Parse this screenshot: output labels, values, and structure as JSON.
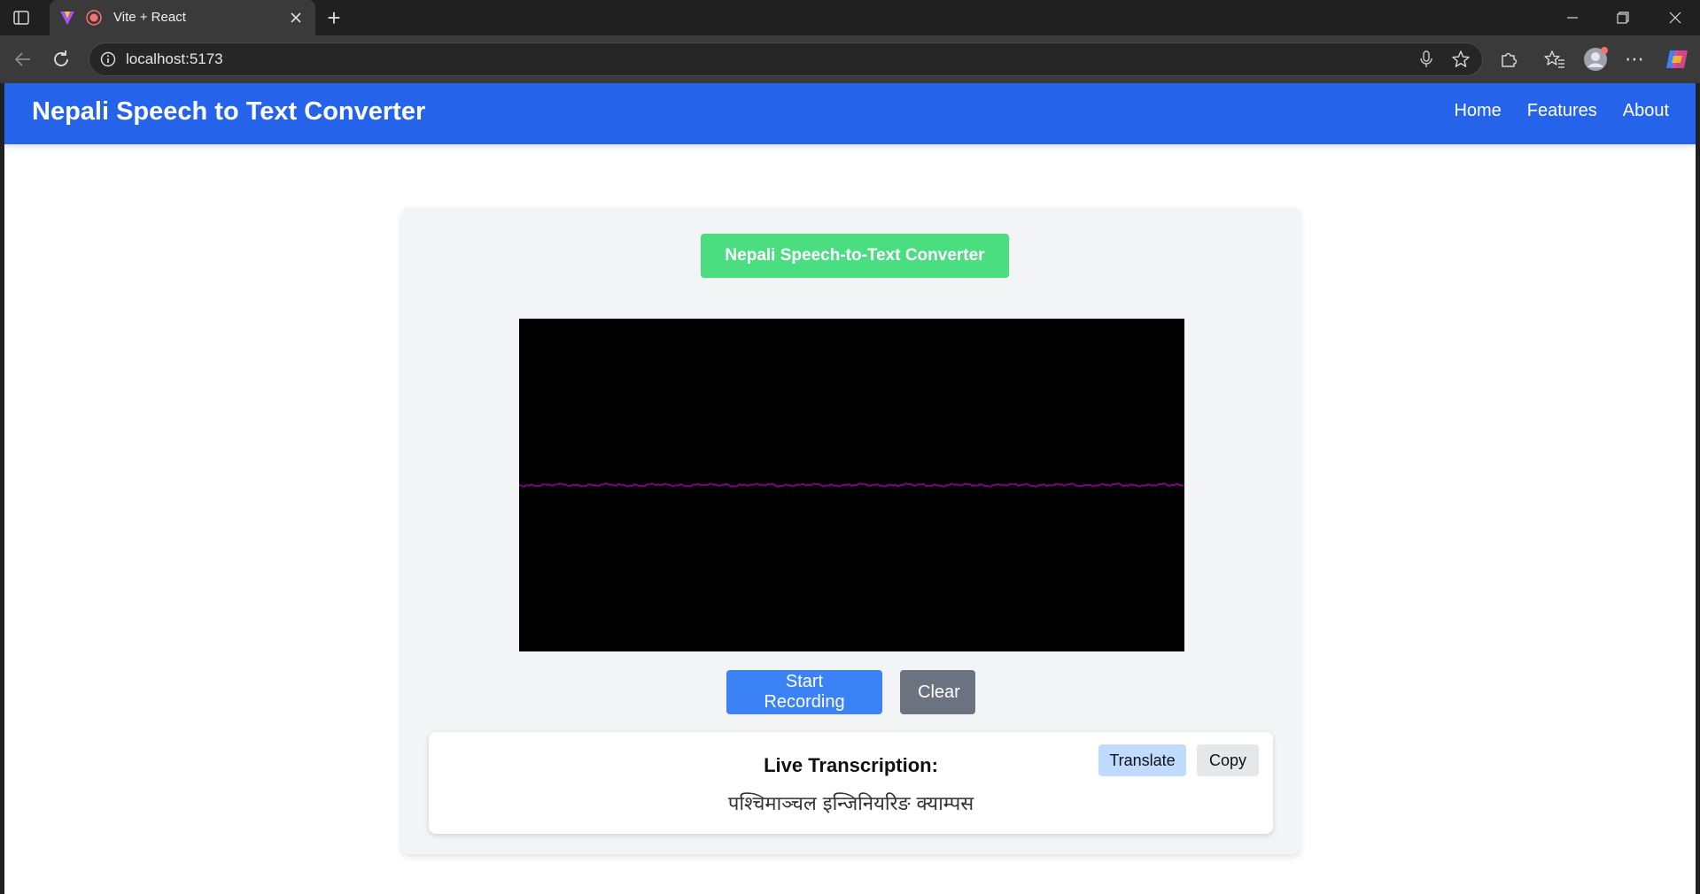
{
  "browser": {
    "tab_title": "Vite + React",
    "url": "localhost:5173",
    "new_tab_symbol": "+",
    "more_symbol": "⋯"
  },
  "navbar": {
    "brand": "Nepali Speech to Text Converter",
    "links": [
      "Home",
      "Features",
      "About"
    ]
  },
  "card": {
    "title": "Nepali Speech-to-Text Converter",
    "waveform_color": "#800080",
    "buttons": {
      "start": "Start Recording",
      "clear": "Clear"
    },
    "transcript": {
      "heading": "Live Transcription:",
      "text": "पश्चिमाञ्चल इन्जिनियरिङ क्याम्पस",
      "translate_label": "Translate",
      "copy_label": "Copy"
    }
  },
  "colors": {
    "navbar": "#2563eb",
    "title_badge": "#4ade80",
    "start_button": "#3b82f6",
    "clear_button": "#6b7280"
  }
}
